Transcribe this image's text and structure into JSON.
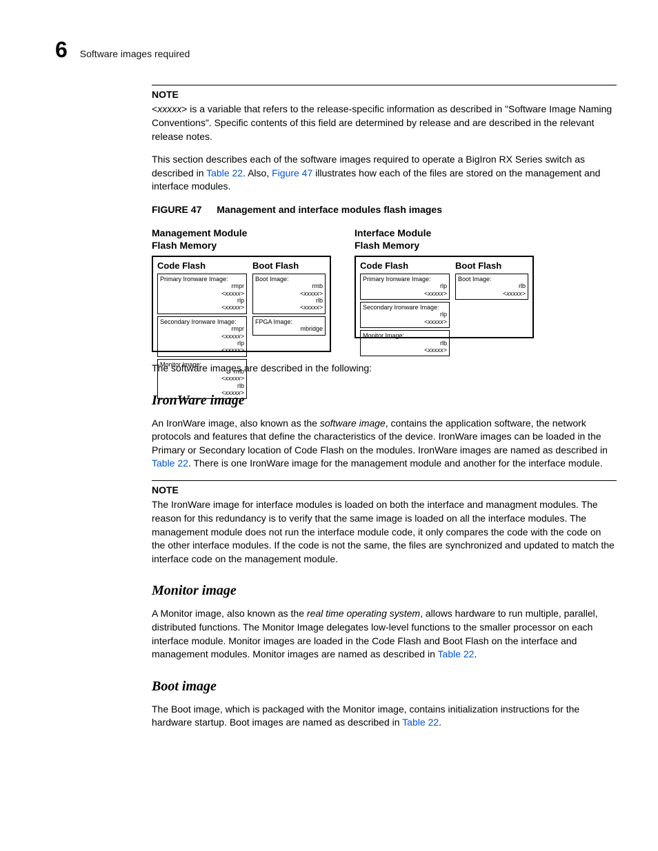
{
  "header": {
    "chapter_number": "6",
    "running_title": "Software images required"
  },
  "note1": {
    "label": "NOTE",
    "body_pre": "<",
    "body_var": "xxxxx",
    "body_post": "> is a variable that refers to the release-specific information as described in \"Software Image Naming Conventions\". Specific contents of this field are determined by release and are described in the relevant release notes."
  },
  "intro": {
    "p1_a": "This section describes each of the software images required to operate a BigIron RX Series switch as described in ",
    "p1_ref1": "Table 22",
    "p1_b": ". Also, ",
    "p1_ref2": "Figure 47",
    "p1_c": " illustrates how each of the files are stored on the management and interface modules."
  },
  "figure": {
    "label": "FIGURE 47",
    "title": "Management and interface modules flash images"
  },
  "diagram": {
    "mgmt": {
      "title_l1": "Management Module",
      "title_l2": "Flash Memory",
      "code_flash_label": "Code Flash",
      "boot_flash_label": "Boot Flash",
      "code_entries": [
        {
          "title": "Primary Ironware Image:",
          "lines": [
            "rmpr<xxxxx>",
            "rlp <xxxxx>"
          ],
          "italic_idx": [
            0,
            1
          ]
        },
        {
          "title": "Secondary Ironware Image:",
          "lines": [
            "rmpr<xxxxx>",
            "rlp <xxxxx>"
          ],
          "italic_idx": [
            0,
            1
          ]
        },
        {
          "title": "Monitor Image:",
          "lines": [
            "rmb <xxxxx>",
            "rlb <xxxxx>"
          ],
          "italic_idx": [
            0,
            1
          ]
        }
      ],
      "boot_entries": [
        {
          "title": "Boot Image:",
          "lines": [
            "rmb <xxxxx>",
            "rlb <xxxxx>"
          ],
          "italic_idx": [
            0,
            1
          ]
        },
        {
          "title": "FPGA Image:",
          "lines": [
            "mbridge"
          ],
          "italic_idx": []
        }
      ]
    },
    "intf": {
      "title_l1": "Interface Module",
      "title_l2": "Flash Memory",
      "code_flash_label": "Code Flash",
      "boot_flash_label": "Boot Flash",
      "code_entries": [
        {
          "title": "Primary Ironware Image:",
          "lines": [
            "rlp <xxxxx>"
          ],
          "italic_idx": [
            0
          ]
        },
        {
          "title": "Secondary Ironware Image:",
          "lines": [
            "rlp <xxxxx>"
          ],
          "italic_idx": [
            0
          ]
        },
        {
          "title": "Monitor Image:",
          "lines": [
            "rlb <xxxxx>"
          ],
          "italic_idx": [
            0
          ]
        }
      ],
      "boot_entries": [
        {
          "title": "Boot Image:",
          "lines": [
            "rlb <xxxxx>"
          ],
          "italic_idx": [
            0
          ]
        }
      ]
    }
  },
  "after_figure": "The software images are described in the following:",
  "ironware": {
    "heading": "IronWare image",
    "p1_a": "An IronWare image, also known as the ",
    "p1_term": "software image",
    "p1_b": ", contains the application software, the network protocols and features that define the characteristics of the device. IronWare images can be loaded in the Primary or Secondary location of Code Flash on the modules. IronWare images are named as described in ",
    "p1_ref": "Table 22",
    "p1_c": ". There is one IronWare image for the management module and another for the interface module.",
    "note_label": "NOTE",
    "note_body": "The IronWare image for interface modules is loaded on both the interface and managment modules. The reason for this redundancy is to verify that the same image is loaded on all the interface modules. The management module does not run the interface module code, it only compares the code with the code on the other interface modules. If the code is not the same, the files are synchronized and updated to match the interface code on the management module."
  },
  "monitor": {
    "heading": "Monitor image",
    "p1_a": "A Monitor image, also known as the ",
    "p1_term": "real time operating system",
    "p1_b": ", allows hardware to run multiple, parallel, distributed functions. The Monitor Image delegates low-level functions to the smaller processor on each interface module. Monitor images are loaded in the Code Flash and Boot Flash on the interface and management modules. Monitor images are named as described in ",
    "p1_ref": "Table 22",
    "p1_c": "."
  },
  "boot": {
    "heading": "Boot image",
    "p1_a": "The Boot image, which is packaged with the Monitor image, contains initialization instructions for the hardware startup. Boot images are named as described in ",
    "p1_ref": "Table 22",
    "p1_b": "."
  }
}
